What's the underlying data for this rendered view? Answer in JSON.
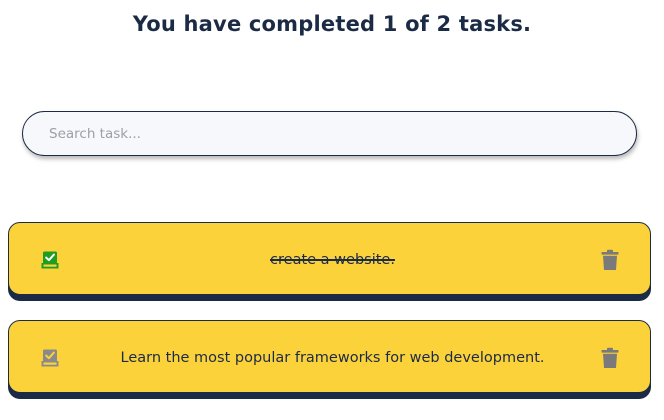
{
  "header": {
    "title": "You have completed 1 of 2 tasks."
  },
  "search": {
    "placeholder": "Search task...",
    "value": ""
  },
  "tasks": [
    {
      "text": "create a website.",
      "completed": true,
      "check_icon": "checkbox-checked-icon",
      "delete_icon": "trash-icon"
    },
    {
      "text": "Learn the most popular frameworks for web development.",
      "completed": false,
      "check_icon": "checkbox-unchecked-icon",
      "delete_icon": "trash-icon"
    }
  ],
  "colors": {
    "primary_text": "#1c2b45",
    "card_background": "#fcd23b",
    "check_completed": "#1f9d1f",
    "check_pending": "#8a8a8a",
    "trash_icon": "#7a7a7a"
  }
}
